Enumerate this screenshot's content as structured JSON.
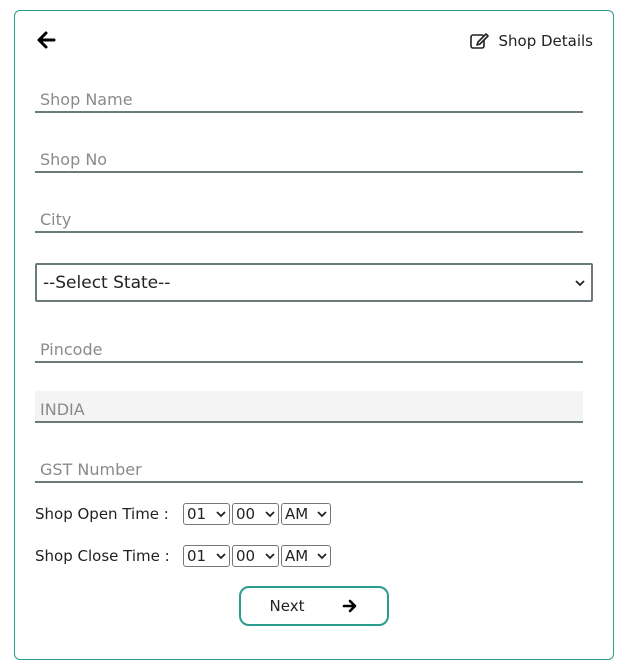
{
  "header": {
    "title": "Shop Details",
    "back_icon": "arrow-left-icon",
    "edit_icon": "edit-square-icon"
  },
  "form": {
    "shop_name_placeholder": "Shop Name",
    "shop_no_placeholder": "Shop No",
    "city_placeholder": "City",
    "state_selected": "--Select State--",
    "pincode_placeholder": "Pincode",
    "country_value": "INDIA",
    "gst_placeholder": "GST Number"
  },
  "open_time": {
    "label": "Shop Open Time :",
    "hour": "01",
    "minute": "00",
    "period": "AM"
  },
  "close_time": {
    "label": "Shop Close Time :",
    "hour": "01",
    "minute": "00",
    "period": "AM"
  },
  "actions": {
    "next_label": "Next",
    "next_icon": "arrow-right-icon"
  },
  "colors": {
    "accent": "#2a9d8f",
    "underline": "#6b7b7b"
  }
}
